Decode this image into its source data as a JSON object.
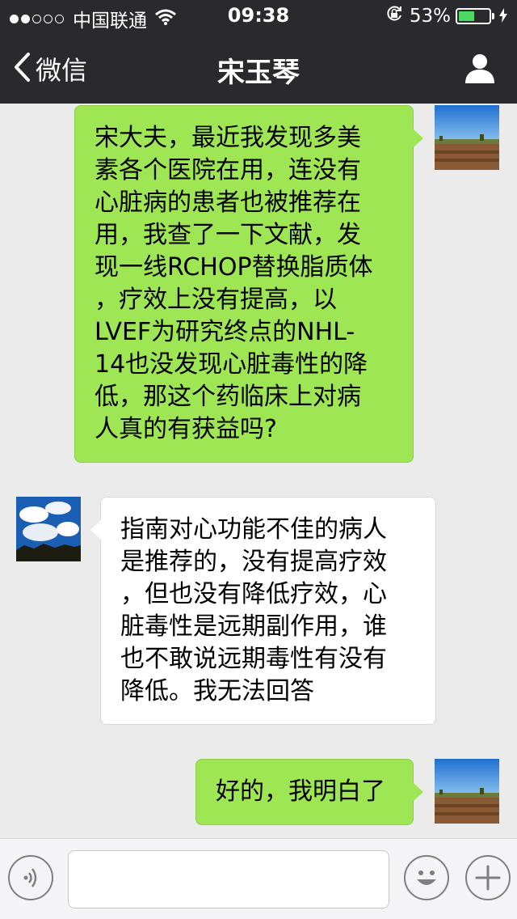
{
  "status_bar": {
    "signal_bars": [
      true,
      true,
      false,
      false,
      false
    ],
    "carrier": "中国联通",
    "time": "09:38",
    "battery_percent_text": "53%",
    "battery_level": 0.53,
    "battery_color": "#4cd964"
  },
  "nav": {
    "back_label": "微信",
    "title": "宋玉琴",
    "background": "#2a2a2e"
  },
  "messages": [
    {
      "sender": "me",
      "text": "宋大夫，最近我发现多美素各个医院在用，连没有心脏病的患者也被推荐在用，我查了一下文献，发现一线RCHOP替换脂质体，疗效上没有提高，以LVEF为研究终点的NHL-14也没发现心脏毒性的降低，那这个药临床上对病人真的有获益吗?",
      "lines": [
        "宋大夫，最近我发现多美",
        "素各个医院在用，连没有",
        "心脏病的患者也被推荐在",
        "用，我查了一下文献，发",
        "现一线RCHOP替换脂质体",
        "，疗效上没有提高，以",
        "LVEF为研究终点的NHL-",
        "14也没发现心脏毒性的降",
        "低，那这个药临床上对病",
        "人真的有获益吗?"
      ]
    },
    {
      "sender": "them",
      "text": "指南对心功能不佳的病人是推荐的，没有提高疗效，但也没有降低疗效，心脏毒性是远期副作用，谁也不敢说远期毒性有没有降低。我无法回答",
      "lines": [
        "指南对心功能不佳的病人",
        "是推荐的，没有提高疗效",
        "，但也没有降低疗效，心",
        "脏毒性是远期副作用，谁",
        "也不敢说远期毒性有没有",
        "降低。我无法回答"
      ]
    },
    {
      "sender": "me",
      "text": "好的，我明白了",
      "lines": [
        "好的，我明白了"
      ]
    }
  ],
  "colors": {
    "my_bubble": "#9ee654",
    "their_bubble": "#ffffff",
    "chat_background": "#ebebeb"
  },
  "input_bar": {
    "voice_icon": "voice-icon",
    "emoji_icon": "emoji-icon",
    "plus_icon": "plus-icon",
    "text_value": ""
  }
}
